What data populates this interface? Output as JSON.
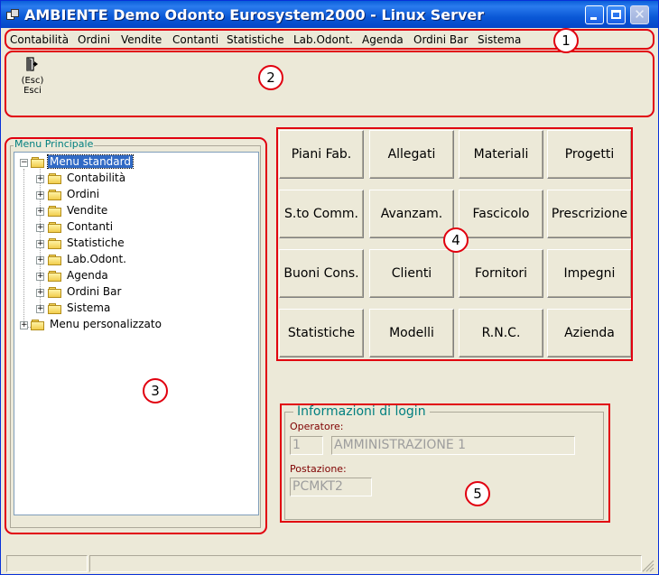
{
  "window": {
    "title": "AMBIENTE Demo Odonto Eurosystem2000 - Linux Server"
  },
  "menu": {
    "items": [
      "Contabilità",
      "Ordini",
      "Vendite",
      "Contanti",
      "Statistiche",
      "Lab.Odont.",
      "Agenda",
      "Ordini Bar",
      "Sistema"
    ]
  },
  "toolbar": {
    "exit_shortcut": "(Esc)",
    "exit_label": "Esci"
  },
  "tree": {
    "legend": "Menu Principale",
    "root_label": "Menu standard",
    "children": [
      "Contabilità",
      "Ordini",
      "Vendite",
      "Contanti",
      "Statistiche",
      "Lab.Odont.",
      "Agenda",
      "Ordini Bar",
      "Sistema"
    ],
    "second_root_label": "Menu personalizzato"
  },
  "buttons": {
    "grid": [
      "Piani Fab.",
      "Allegati",
      "Materiali",
      "Progetti",
      "S.to Comm.",
      "Avanzam.",
      "Fascicolo",
      "Prescrizione",
      "Buoni Cons.",
      "Clienti",
      "Fornitori",
      "Impegni",
      "Statistiche",
      "Modelli",
      "R.N.C.",
      "Azienda"
    ]
  },
  "login": {
    "legend": "Informazioni di login",
    "operatore_label": "Operatore:",
    "operatore_id": "1",
    "operatore_name": "AMMINISTRAZIONE 1",
    "postazione_label": "Postazione:",
    "postazione_value": "PCMKT2"
  },
  "annotations": [
    "1",
    "2",
    "3",
    "4",
    "5"
  ],
  "icons": {
    "exit": "exit-door-icon",
    "folder": "folder-icon",
    "expand": "plus-expander-icon",
    "collapse": "minus-expander-icon"
  },
  "colors": {
    "title_bar": "#0a58d6",
    "highlight_red": "#e1000f",
    "legend_teal": "#007f7f",
    "tree_selection": "#316ac5"
  }
}
